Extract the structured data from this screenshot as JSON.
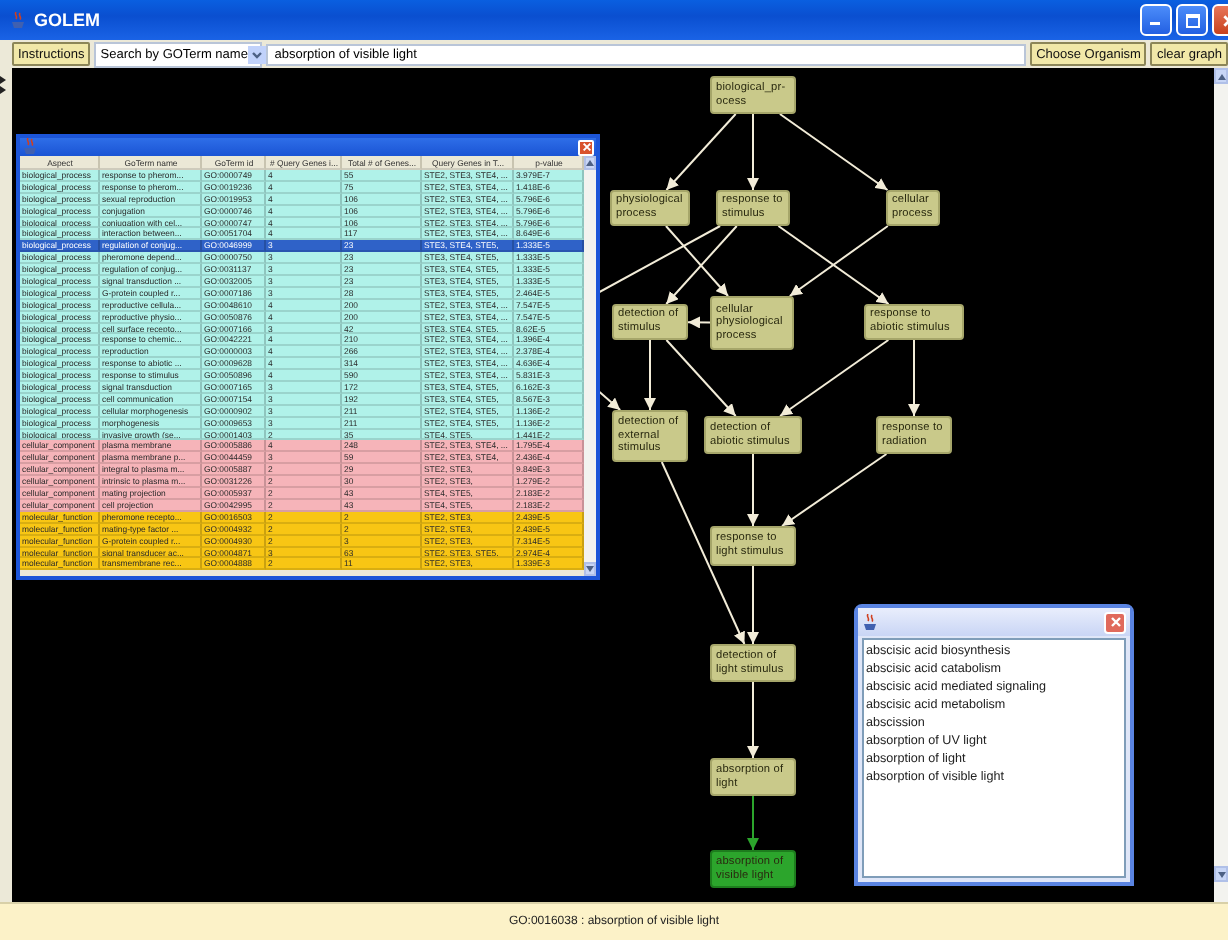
{
  "window": {
    "title": "GOLEM"
  },
  "toolbar": {
    "instructions_button": "Instructions",
    "search_mode": "Search by GOTerm name",
    "search_value": "absorption of visible light",
    "choose_organism_button": "Choose Organism",
    "clear_graph_button": "clear graph"
  },
  "results_table": {
    "columns": [
      "Aspect",
      "GoTerm name",
      "GoTerm id",
      "# Query Genes i...",
      "Total # of Genes...",
      "Query Genes in T...",
      "p-value"
    ],
    "rows": [
      {
        "cells": [
          "biological_process",
          "response to pherom...",
          "GO:0000749",
          "4",
          "55",
          "STE2, STE3, STE4, ...",
          "3.979E-7"
        ],
        "color": "#b0f2e9",
        "selected": false
      },
      {
        "cells": [
          "biological_process",
          "response to pherom...",
          "GO:0019236",
          "4",
          "75",
          "STE2, STE3, STE4, ...",
          "1.418E-6"
        ],
        "color": "#b0f2e9",
        "selected": false
      },
      {
        "cells": [
          "biological_process",
          "sexual reproduction",
          "GO:0019953",
          "4",
          "106",
          "STE2, STE3, STE4, ...",
          "5.796E-6"
        ],
        "color": "#b0f2e9",
        "selected": false
      },
      {
        "cells": [
          "biological_process",
          "conjugation",
          "GO:0000746",
          "4",
          "106",
          "STE2, STE3, STE4, ...",
          "5.796E-6"
        ],
        "color": "#b0f2e9",
        "selected": false
      },
      {
        "cells": [
          "biological_process",
          "conjugation with cel...",
          "GO:0000747",
          "4",
          "106",
          "STE2, STE3, STE4, ...",
          "5.796E-6"
        ],
        "color": "#b0f2e9",
        "selected": false
      },
      {
        "cells": [
          "biological_process",
          "interaction between...",
          "GO:0051704",
          "4",
          "117",
          "STE2, STE3, STE4, ...",
          "8.649E-6"
        ],
        "color": "#b0f2e9",
        "selected": false
      },
      {
        "cells": [
          "biological_process",
          "regulation of conjug...",
          "GO:0046999",
          "3",
          "23",
          "STE3, STE4, STE5,",
          "1.333E-5"
        ],
        "selected": true
      },
      {
        "cells": [
          "biological_process",
          "pheromone depend...",
          "GO:0000750",
          "3",
          "23",
          "STE3, STE4, STE5,",
          "1.333E-5"
        ],
        "color": "#b0f2e9",
        "selected": false
      },
      {
        "cells": [
          "biological_process",
          "regulation of conjug...",
          "GO:0031137",
          "3",
          "23",
          "STE3, STE4, STE5,",
          "1.333E-5"
        ],
        "color": "#b0f2e9",
        "selected": false
      },
      {
        "cells": [
          "biological_process",
          "signal transduction ...",
          "GO:0032005",
          "3",
          "23",
          "STE3, STE4, STE5,",
          "1.333E-5"
        ],
        "color": "#b0f2e9",
        "selected": false
      },
      {
        "cells": [
          "biological_process",
          "G-protein coupled r...",
          "GO:0007186",
          "3",
          "28",
          "STE3, STE4, STE5,",
          "2.464E-5"
        ],
        "color": "#b0f2e9",
        "selected": false
      },
      {
        "cells": [
          "biological_process",
          "reproductive cellula...",
          "GO:0048610",
          "4",
          "200",
          "STE2, STE3, STE4, ...",
          "7.547E-5"
        ],
        "color": "#b0f2e9",
        "selected": false
      },
      {
        "cells": [
          "biological_process",
          "reproductive physio...",
          "GO:0050876",
          "4",
          "200",
          "STE2, STE3, STE4, ...",
          "7.547E-5"
        ],
        "color": "#b0f2e9",
        "selected": false
      },
      {
        "cells": [
          "biological_process",
          "cell surface recepto...",
          "GO:0007166",
          "3",
          "42",
          "STE3, STE4, STE5,",
          "8.62E-5"
        ],
        "color": "#b0f2e9",
        "selected": false
      },
      {
        "cells": [
          "biological_process",
          "response to chemic...",
          "GO:0042221",
          "4",
          "210",
          "STE2, STE3, STE4, ...",
          "1.396E-4"
        ],
        "color": "#b0f2e9",
        "selected": false
      },
      {
        "cells": [
          "biological_process",
          "reproduction",
          "GO:0000003",
          "4",
          "266",
          "STE2, STE3, STE4, ...",
          "2.378E-4"
        ],
        "color": "#b0f2e9",
        "selected": false
      },
      {
        "cells": [
          "biological_process",
          "response to abiotic ...",
          "GO:0009628",
          "4",
          "314",
          "STE2, STE3, STE4, ...",
          "4.636E-4"
        ],
        "color": "#b0f2e9",
        "selected": false
      },
      {
        "cells": [
          "biological_process",
          "response to stimulus",
          "GO:0050896",
          "4",
          "590",
          "STE2, STE3, STE4, ...",
          "5.831E-3"
        ],
        "color": "#b0f2e9",
        "selected": false
      },
      {
        "cells": [
          "biological_process",
          "signal transduction",
          "GO:0007165",
          "3",
          "172",
          "STE3, STE4, STE5,",
          "6.162E-3"
        ],
        "color": "#b0f2e9",
        "selected": false
      },
      {
        "cells": [
          "biological_process",
          "cell communication",
          "GO:0007154",
          "3",
          "192",
          "STE3, STE4, STE5,",
          "8.567E-3"
        ],
        "color": "#b0f2e9",
        "selected": false
      },
      {
        "cells": [
          "biological_process",
          "cellular morphogenesis",
          "GO:0000902",
          "3",
          "211",
          "STE2, STE4, STE5,",
          "1.136E-2"
        ],
        "color": "#b0f2e9",
        "selected": false
      },
      {
        "cells": [
          "biological_process",
          "morphogenesis",
          "GO:0009653",
          "3",
          "211",
          "STE2, STE4, STE5,",
          "1.136E-2"
        ],
        "color": "#b0f2e9",
        "selected": false
      },
      {
        "cells": [
          "biological_process",
          "invasive growth (se...",
          "GO:0001403",
          "2",
          "35",
          "STE4, STE5,",
          "1.441E-2"
        ],
        "color": "#b0f2e9",
        "selected": false
      },
      {
        "cells": [
          "cellular_component",
          "plasma membrane",
          "GO:0005886",
          "4",
          "248",
          "STE2, STE3, STE4, ...",
          "1.795E-4"
        ],
        "color": "#f6b4b9",
        "selected": false
      },
      {
        "cells": [
          "cellular_component",
          "plasma membrane p...",
          "GO:0044459",
          "3",
          "59",
          "STE2, STE3, STE4,",
          "2.436E-4"
        ],
        "color": "#f6b4b9",
        "selected": false
      },
      {
        "cells": [
          "cellular_component",
          "integral to plasma m...",
          "GO:0005887",
          "2",
          "29",
          "STE2, STE3,",
          "9.849E-3"
        ],
        "color": "#f6b4b9",
        "selected": false
      },
      {
        "cells": [
          "cellular_component",
          "intrinsic to plasma m...",
          "GO:0031226",
          "2",
          "30",
          "STE2, STE3,",
          "1.279E-2"
        ],
        "color": "#f6b4b9",
        "selected": false
      },
      {
        "cells": [
          "cellular_component",
          "mating projection",
          "GO:0005937",
          "2",
          "43",
          "STE4, STE5,",
          "2.183E-2"
        ],
        "color": "#f6b4b9",
        "selected": false
      },
      {
        "cells": [
          "cellular_component",
          "cell projection",
          "GO:0042995",
          "2",
          "43",
          "STE4, STE5,",
          "2.183E-2"
        ],
        "color": "#f6b4b9",
        "selected": false
      },
      {
        "cells": [
          "molecular_function",
          "pheromone recepto...",
          "GO:0016503",
          "2",
          "2",
          "STE2, STE3,",
          "2.439E-5"
        ],
        "color": "#f8c614",
        "selected": false
      },
      {
        "cells": [
          "molecular_function",
          "mating-type factor ...",
          "GO:0004932",
          "2",
          "2",
          "STE2, STE3,",
          "2.439E-5"
        ],
        "color": "#f8c614",
        "selected": false
      },
      {
        "cells": [
          "molecular_function",
          "G-protein coupled r...",
          "GO:0004930",
          "2",
          "3",
          "STE2, STE3,",
          "7.314E-5"
        ],
        "color": "#f8c614",
        "selected": false
      },
      {
        "cells": [
          "molecular_function",
          "signal transducer ac...",
          "GO:0004871",
          "3",
          "63",
          "STE2, STE3, STE5,",
          "2.974E-4"
        ],
        "color": "#f8c614",
        "selected": false
      },
      {
        "cells": [
          "molecular_function",
          "transmembrane rec...",
          "GO:0004888",
          "2",
          "11",
          "STE2, STE3,",
          "1.339E-3"
        ],
        "color": "#f8c614",
        "selected": false
      }
    ]
  },
  "graph": {
    "nodes": [
      {
        "label": "biological_pr-ocess",
        "selected": false
      },
      {
        "label": "physiological process",
        "selected": false
      },
      {
        "label": "response to stimulus",
        "selected": false
      },
      {
        "label": "cellular process",
        "selected": false
      },
      {
        "label": "detection of stimulus",
        "selected": false
      },
      {
        "label": "cellular physiological process",
        "selected": false
      },
      {
        "label": "response to abiotic stimulus",
        "selected": false
      },
      {
        "label": "detection of external stimulus",
        "selected": false
      },
      {
        "label": "detection of abiotic stimulus",
        "selected": false
      },
      {
        "label": "response to radiation",
        "selected": false
      },
      {
        "label": "response to light stimulus",
        "selected": false
      },
      {
        "label": "detection of light stimulus",
        "selected": false
      },
      {
        "label": "absorption of light",
        "selected": false
      },
      {
        "label": "absorption of visible light",
        "selected": true
      }
    ]
  },
  "term_list": {
    "items": [
      "abscisic acid biosynthesis",
      "abscisic acid catabolism",
      "abscisic acid mediated signaling",
      "abscisic acid metabolism",
      "abscission",
      "absorption of UV light",
      "absorption of light",
      "absorption of visible light"
    ]
  },
  "status_bar": "GO:0016038 : absorption of visible light"
}
